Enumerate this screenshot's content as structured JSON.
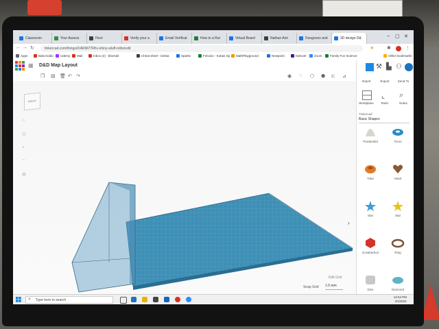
{
  "browser": {
    "tabs": [
      {
        "label": "Classroom",
        "color": "#1a73e8"
      },
      {
        "label": "Your Assess",
        "color": "#2b9348"
      },
      {
        "label": "Flexi",
        "color": "#3c4043"
      },
      {
        "label": "Verify your a",
        "color": "#d93025"
      },
      {
        "label": "Email Verificat",
        "color": "#1a73e8"
      },
      {
        "label": "How to a Rur",
        "color": "#188038"
      },
      {
        "label": "Virtual Board",
        "color": "#1a73e8"
      },
      {
        "label": "Nathan Ann",
        "color": "#3c4043"
      },
      {
        "label": "Dungeons and",
        "color": "#1a73e8"
      },
      {
        "label": "3D design D&",
        "color": "#1a73e8"
      }
    ],
    "url": "tinkercad.com/things/2rAKMi77Rhv-shiny-wluff-rottis/edit",
    "bookmarks": [
      {
        "label": "Apps",
        "color": "#5f6368"
      },
      {
        "label": "Bala Kiddo",
        "color": "#d93025"
      },
      {
        "label": "Udemy",
        "color": "#a435f0"
      },
      {
        "label": "Mail",
        "color": "#d93025"
      },
      {
        "label": "Inbox (2) - bisende",
        "color": "#d93025"
      },
      {
        "label": "Cheat sheet - lamba",
        "color": "#3c4043"
      },
      {
        "label": "Sparks",
        "color": "#1a73e8"
      },
      {
        "label": "Fimosio - Kubas Sp",
        "color": "#188038"
      },
      {
        "label": "MathPlayground",
        "color": "#f29900"
      },
      {
        "label": "Newpoint",
        "color": "#1a73e8"
      },
      {
        "label": "Kahoot!",
        "color": "#46178f"
      },
      {
        "label": "Zoom",
        "color": "#2d8cff"
      },
      {
        "label": "Family Fun Science",
        "color": "#188038"
      },
      {
        "label": "Other bookmarks",
        "color": "#f4b400"
      }
    ]
  },
  "app": {
    "title": "D&D Map Layout",
    "viewcube_label": "RIGHT",
    "edit_grid": "Edit Grid",
    "snap_grid_label": "Snap Grid",
    "snap_grid_value": "1.0 mm"
  },
  "panel": {
    "import": "Import",
    "export": "Export",
    "send_to": "Send To",
    "workplane": "Workplane",
    "ruler": "Ruler",
    "notes": "Notes",
    "library_label": "Tinkercad",
    "library_value": "Basic Shapes",
    "shapes": [
      {
        "label": "Paraboloid",
        "color": "#d9d5cc",
        "icon": "paraboloid-icon"
      },
      {
        "label": "Torus",
        "color": "#2a8fc7",
        "icon": "torus-icon"
      },
      {
        "label": "Tube",
        "color": "#e57a25",
        "icon": "tube-icon"
      },
      {
        "label": "Heart",
        "color": "#8a5a36",
        "icon": "heart-icon"
      },
      {
        "label": "Star",
        "color": "#3c9fd6",
        "icon": "star-icon"
      },
      {
        "label": "Star",
        "color": "#e8c21f",
        "icon": "star-icon"
      },
      {
        "label": "Icosahedron",
        "color": "#d6312a",
        "icon": "icosahedron-icon"
      },
      {
        "label": "Ring",
        "color": "#7a5235",
        "icon": "ring-icon"
      },
      {
        "label": "Dice",
        "color": "#c9c9c9",
        "icon": "dice-icon"
      },
      {
        "label": "Diamond",
        "color": "#5fb3c4",
        "icon": "diamond-icon"
      }
    ]
  },
  "taskbar": {
    "search_placeholder": "Type here to search",
    "time": "12:54 PM",
    "date": "4/1/2021"
  },
  "model": {
    "box_color": "#3e8fb6",
    "wall_color": "#5c9cc4"
  }
}
